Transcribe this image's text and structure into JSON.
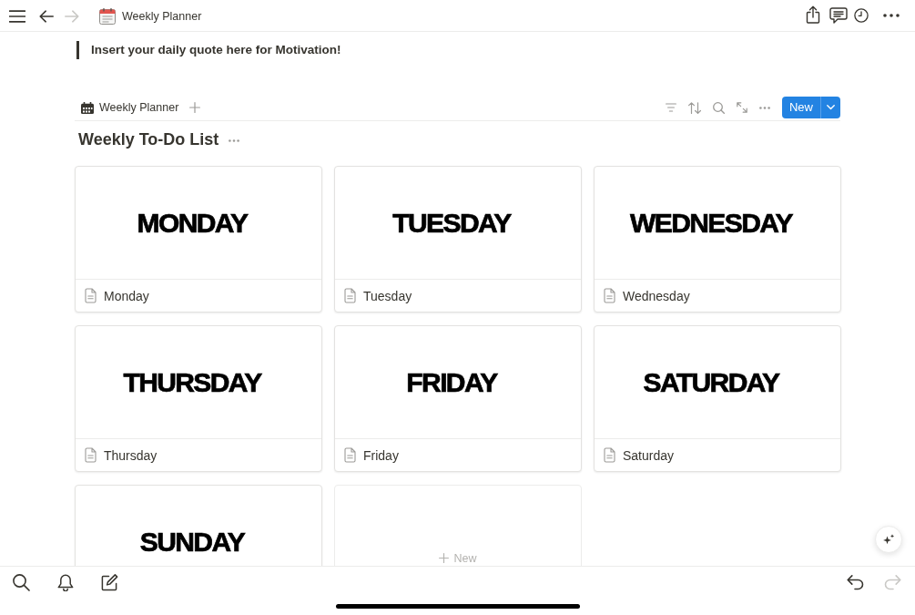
{
  "top_bar": {
    "back": {
      "disabled": false
    },
    "forward": {
      "disabled": true
    },
    "title": "Weekly Planner"
  },
  "quote": "Insert your daily quote here for Motivation!",
  "database": {
    "view_tab": {
      "label": "Weekly Planner"
    },
    "new_button": {
      "label": "New"
    },
    "title": "Weekly To-Do List",
    "cards": [
      {
        "kind": "page",
        "cover_text": "MONDAY",
        "title": "Monday"
      },
      {
        "kind": "page",
        "cover_text": "TUESDAY",
        "title": "Tuesday"
      },
      {
        "kind": "page",
        "cover_text": "WEDNESDAY",
        "title": "Wednesday"
      },
      {
        "kind": "page",
        "cover_text": "THURSDAY",
        "title": "Thursday"
      },
      {
        "kind": "page",
        "cover_text": "FRIDAY",
        "title": "Friday"
      },
      {
        "kind": "page",
        "cover_text": "SATURDAY",
        "title": "Saturday"
      },
      {
        "kind": "page",
        "cover_text": "SUNDAY"
      },
      {
        "kind": "add",
        "label": "New"
      }
    ]
  },
  "bottom_bar": {
    "undo": {
      "disabled": false
    },
    "redo": {
      "disabled": true
    }
  }
}
